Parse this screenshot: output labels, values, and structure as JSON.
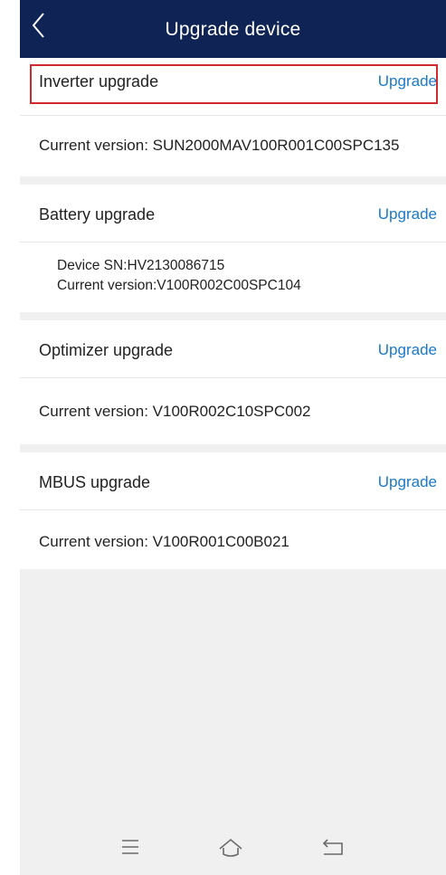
{
  "header": {
    "title": "Upgrade device"
  },
  "sections": [
    {
      "label": "Inverter upgrade",
      "action": "Upgrade",
      "info": [
        "Current version:  SUN2000MAV100R001C00SPC135"
      ]
    },
    {
      "label": "Battery upgrade",
      "action": "Upgrade",
      "info": [
        "Device SN:HV2130086715",
        "Current version:V100R002C00SPC104"
      ]
    },
    {
      "label": "Optimizer upgrade",
      "action": "Upgrade",
      "info": [
        "Current version:  V100R002C10SPC002"
      ]
    },
    {
      "label": "MBUS upgrade",
      "action": "Upgrade",
      "info": [
        "Current version:  V100R001C00B021"
      ]
    }
  ],
  "colors": {
    "titlebar": "#0f2455",
    "link": "#1a79c9",
    "highlight": "#d0292e",
    "background": "#f0f0f0"
  },
  "icons": {
    "back": "chevron-left-icon",
    "menu": "menu-icon",
    "home": "home-icon",
    "return": "back-arrow-icon"
  }
}
